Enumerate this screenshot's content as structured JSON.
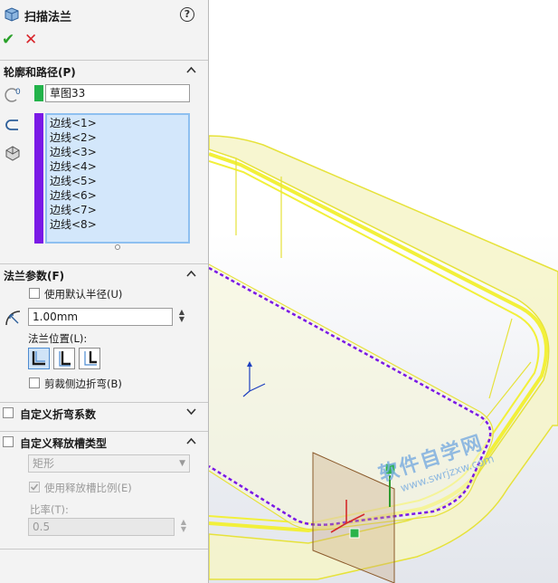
{
  "feature": {
    "title": "扫描法兰",
    "help": "?"
  },
  "profile_path": {
    "title": "轮廓和路径(P)",
    "profile_value": "草图33",
    "path_edges": [
      "边线<1>",
      "边线<2>",
      "边线<3>",
      "边线<4>",
      "边线<5>",
      "边线<6>",
      "边线<7>",
      "边线<8>"
    ]
  },
  "flange_params": {
    "title": "法兰参数(F)",
    "use_default_radius": "使用默认半径(U)",
    "radius_value": "1.00mm",
    "position_label": "法兰位置(L):",
    "trim_side_bends": "剪裁侧边折弯(B)"
  },
  "custom_bend": {
    "title": "自定义折弯系数"
  },
  "custom_relief": {
    "title": "自定义释放槽类型",
    "type_value": "矩形",
    "use_ratio": "使用释放槽比例(E)",
    "ratio_label": "比率(T):",
    "ratio_value": "0.5"
  },
  "watermark": {
    "line1": "软件自学网",
    "line2": "www.swrjzxw.com"
  },
  "colors": {
    "profile_green": "#22b34a",
    "path_purple": "#7a19e6",
    "model_yellow": "#f2f03a"
  }
}
